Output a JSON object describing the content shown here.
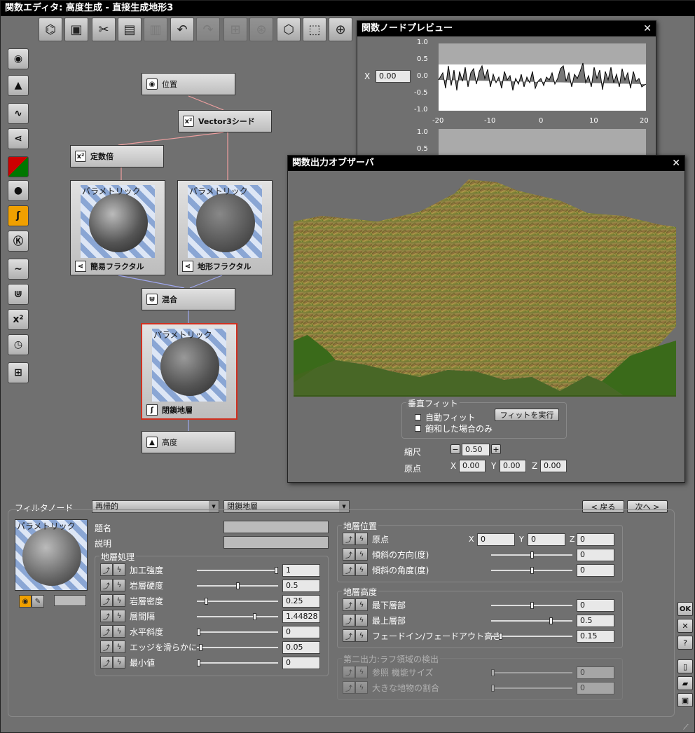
{
  "window": {
    "title": "関数エディタ: 高度生成 - 直接生成地形3"
  },
  "toolbar": {
    "icons": [
      "graph-tree-icon",
      "preview-icon",
      "cut-icon",
      "copy-icon",
      "paste-icon",
      "undo-icon",
      "redo-icon",
      "group-icon",
      "ungroup-icon",
      "zoom-fit-icon",
      "zoom-select-icon",
      "zoom-in-icon"
    ]
  },
  "left_tools": [
    "input-node-icon",
    "output-node-icon",
    "wave-icon",
    "fractal-icon",
    "color-icon",
    "sphere-icon",
    "filter-icon",
    "constant-icon",
    "curve-icon",
    "combiner-icon",
    "math-icon",
    "timer-icon",
    "group-node-icon"
  ],
  "nodes": {
    "position": "位置",
    "seed": "Vector3シード",
    "multiplier": "定数倍",
    "simple_fractal": "簡易フラクタル",
    "terrain_fractal": "地形フラクタル",
    "parametric": "パラメトリック",
    "mix": "混合",
    "closed_strata": "閉鎖地層",
    "altitude": "高度"
  },
  "preview": {
    "title": "関数ノードプレビュー",
    "x_label": "X",
    "x_value": "0.00",
    "yticks": [
      "1.0",
      "0.5",
      "0.0",
      "-0.5",
      "-1.0"
    ],
    "xticks": [
      "-20",
      "-10",
      "0",
      "10",
      "20"
    ],
    "yticks2": [
      "1.0",
      "0.5"
    ]
  },
  "observer": {
    "title": "関数出力オブザーバ",
    "vfit_title": "垂直フィット",
    "auto_fit": "自動フィット",
    "saturated_only": "飽和した場合のみ",
    "run_fit": "フィットを実行",
    "scale_label": "縮尺",
    "scale_value": "0.50",
    "origin_label": "原点",
    "ox": "0.00",
    "oy": "0.00",
    "oz": "0.00",
    "minus": "−",
    "plus": "+",
    "x": "X",
    "y": "Y",
    "z": "Z"
  },
  "props": {
    "filter_label": "フィルタノード",
    "mode": "再帰的",
    "type": "閉鎖地層",
    "prev": "< 戻る",
    "next": "次へ >",
    "thumb_text": "パラメトリック",
    "name_label": "題名",
    "desc_label": "説明",
    "strata_title": "地層処理",
    "strata": [
      {
        "label": "加工強度",
        "value": "1",
        "frac": 1.0
      },
      {
        "label": "岩層硬度",
        "value": "0.5",
        "frac": 0.5
      },
      {
        "label": "岩層密度",
        "value": "0.25",
        "frac": 0.1
      },
      {
        "label": "層間隔",
        "value": "1.44828",
        "frac": 0.72
      },
      {
        "label": "水平斜度",
        "value": "0",
        "frac": 0.0
      },
      {
        "label": "エッジを滑らかに",
        "value": "0.05",
        "frac": 0.03
      },
      {
        "label": "最小値",
        "value": "0",
        "frac": 0.0
      }
    ],
    "pos_title": "地層位置",
    "origin": "原点",
    "ox": "0",
    "oy": "0",
    "oz": "0",
    "slope_dir": "傾斜の方向(度)",
    "slope_dir_v": "0",
    "slope_ang": "傾斜の角度(度)",
    "slope_ang_v": "0",
    "height_title": "地層高度",
    "heights": [
      {
        "label": "最下層部",
        "value": "0",
        "frac": 0.5
      },
      {
        "label": "最上層部",
        "value": "0.5",
        "frac": 0.75
      },
      {
        "label": "フェードイン/フェードアウト高さ",
        "value": "0.15",
        "frac": 0.1
      }
    ],
    "second_title": "第二出力:ラフ領域の検出",
    "second": [
      {
        "label": "参照 機能サイズ",
        "value": "0"
      },
      {
        "label": "大きな地物の割合",
        "value": "0"
      }
    ]
  },
  "side_buttons": {
    "ok": "OK"
  }
}
